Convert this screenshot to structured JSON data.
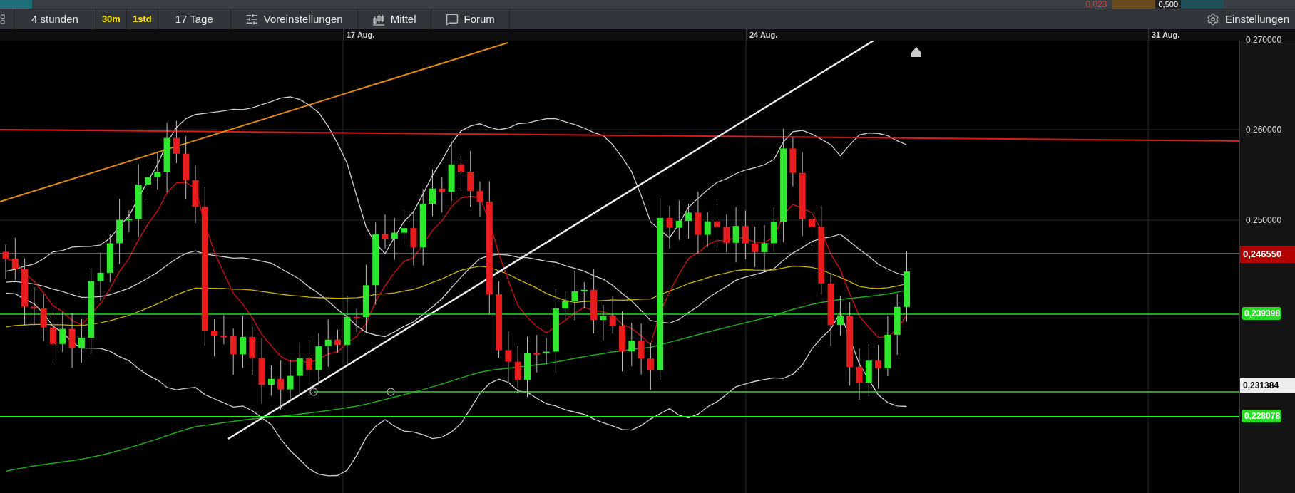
{
  "top_strip": {
    "change": "0,023",
    "value": "0,500"
  },
  "toolbar": {
    "items": [
      {
        "kind": "text",
        "label": "4 stunden"
      },
      {
        "kind": "highlight",
        "label": "30m"
      },
      {
        "kind": "highlight",
        "label": "1std"
      },
      {
        "kind": "text",
        "label": "17 Tage"
      },
      {
        "kind": "presets",
        "label": "Voreinstellungen"
      },
      {
        "kind": "indicators",
        "label": "Mittel"
      },
      {
        "kind": "forum",
        "label": "Forum"
      }
    ],
    "settings": "Einstellungen"
  },
  "date_axis": [
    "17 Aug.",
    "24 Aug.",
    "31 Aug."
  ],
  "price_axis": {
    "ticks": [
      "0,270000",
      "0,260000",
      "0,250000"
    ],
    "tags": [
      {
        "kind": "current",
        "label": "0,246550",
        "color": "#b30000"
      },
      {
        "kind": "level",
        "label": "0,239398",
        "color": "#22dd22"
      },
      {
        "kind": "cursor",
        "label": "0,231384",
        "color": "#eeeeee"
      },
      {
        "kind": "level",
        "label": "0,228078",
        "color": "#22dd22"
      }
    ]
  }
}
